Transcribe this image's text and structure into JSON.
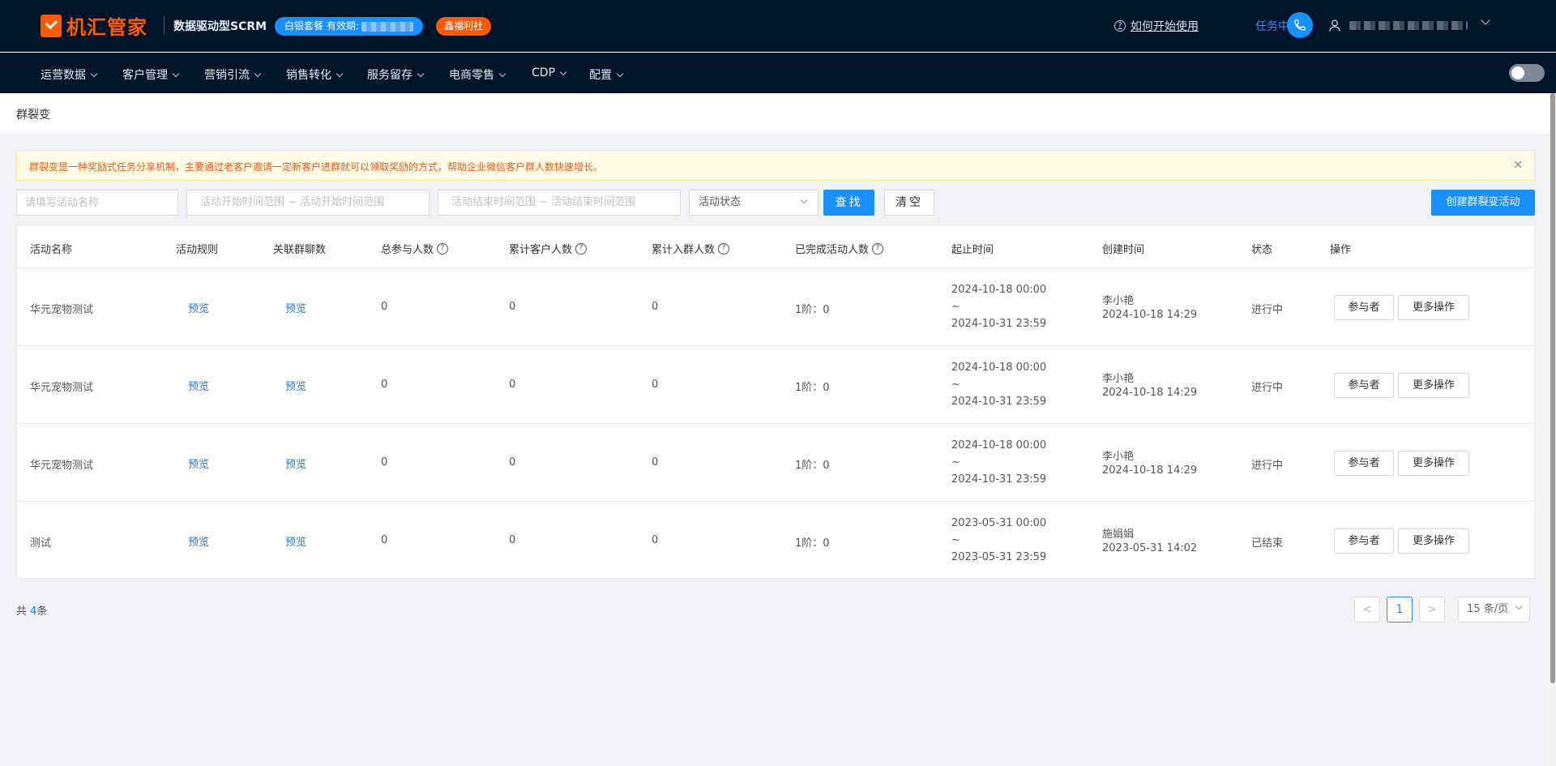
{
  "header": {
    "logo_text": "机汇管家",
    "product_name": "数据驱动型SCRM",
    "plan_badge": "白银套餐 有效期:",
    "welfare_badge": "鑫福利社",
    "help_link": "如何开始使用",
    "task_center": "任务中心"
  },
  "nav": {
    "items": [
      {
        "label": "运营数据"
      },
      {
        "label": "客户管理"
      },
      {
        "label": "营销引流"
      },
      {
        "label": "销售转化"
      },
      {
        "label": "服务留存"
      },
      {
        "label": "电商零售"
      },
      {
        "label": "CDP"
      },
      {
        "label": "配置"
      }
    ]
  },
  "page": {
    "title": "群裂变",
    "notice": "群裂变是一种奖励式任务分享机制，主要通过老客户邀请一定新客户进群就可以领取奖励的方式，帮助企业微信客户群人数快速增长。"
  },
  "filters": {
    "name_placeholder": "请填写活动名称",
    "start_range": "活动开始时间范围 ~ 活动开始时间范围",
    "end_range": "活动结束时间范围 ~ 活动结束时间范围",
    "status_placeholder": "活动状态",
    "search_label": "查找",
    "clear_label": "清空",
    "create_label": "创建群裂变活动"
  },
  "table": {
    "columns": [
      "活动名称",
      "活动规则",
      "关联群聊数",
      "总参与人数",
      "累计客户人数",
      "累计入群人数",
      "已完成活动人数",
      "起止时间",
      "创建时间",
      "状态",
      "操作"
    ],
    "rows": [
      {
        "name": "华元宠物测试",
        "rule": "预览",
        "groups": "预览",
        "total": "0",
        "customers": "0",
        "joined": "0",
        "completed": "1阶：0",
        "start": "2024-10-18 00:00",
        "tilde": "~",
        "end": "2024-10-31 23:59",
        "creator": "李小艳",
        "created_at": "2024-10-18 14:29",
        "status": "进行中",
        "btn_participants": "参与者",
        "btn_more": "更多操作"
      },
      {
        "name": "华元宠物测试",
        "rule": "预览",
        "groups": "预览",
        "total": "0",
        "customers": "0",
        "joined": "0",
        "completed": "1阶：0",
        "start": "2024-10-18 00:00",
        "tilde": "~",
        "end": "2024-10-31 23:59",
        "creator": "李小艳",
        "created_at": "2024-10-18 14:29",
        "status": "进行中",
        "btn_participants": "参与者",
        "btn_more": "更多操作"
      },
      {
        "name": "华元宠物测试",
        "rule": "预览",
        "groups": "预览",
        "total": "0",
        "customers": "0",
        "joined": "0",
        "completed": "1阶：0",
        "start": "2024-10-18 00:00",
        "tilde": "~",
        "end": "2024-10-31 23:59",
        "creator": "李小艳",
        "created_at": "2024-10-18 14:29",
        "status": "进行中",
        "btn_participants": "参与者",
        "btn_more": "更多操作"
      },
      {
        "name": "测试",
        "rule": "预览",
        "groups": "预览",
        "total": "0",
        "customers": "0",
        "joined": "0",
        "completed": "1阶：0",
        "start": "2023-05-31 00:00",
        "tilde": "~",
        "end": "2023-05-31 23:59",
        "creator": "施娟娟",
        "created_at": "2023-05-31 14:02",
        "status": "已结束",
        "btn_participants": "参与者",
        "btn_more": "更多操作"
      }
    ]
  },
  "footer": {
    "total_prefix": "共",
    "total_count": "4",
    "total_suffix": "条",
    "current_page": "1",
    "prev": "<",
    "next": ">",
    "page_size": "15 条/页"
  },
  "colors": {
    "header_bg": "#001529",
    "brand_orange": "#ff5a00",
    "primary_blue": "#1890ff"
  }
}
